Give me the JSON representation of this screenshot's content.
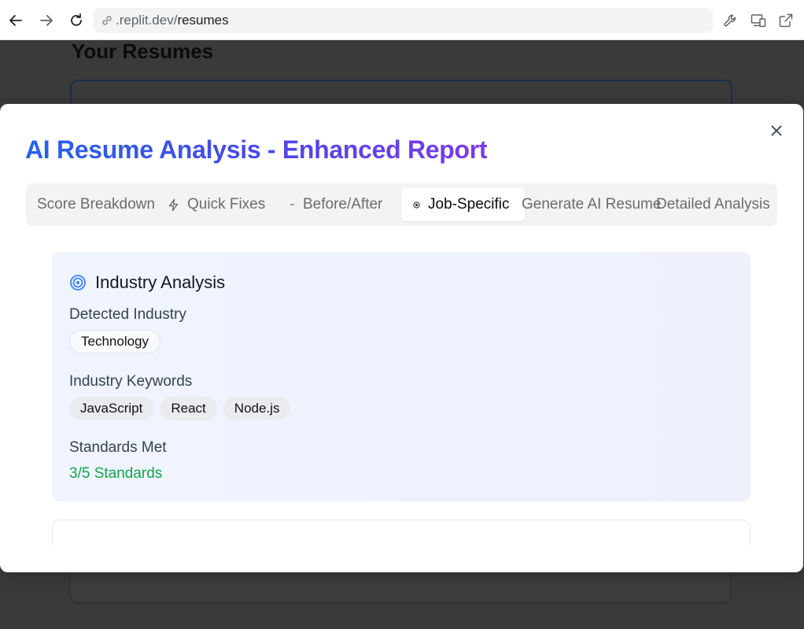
{
  "browser": {
    "url_prefix": ".replit.dev/",
    "url_path": "resumes",
    "icons": {
      "back": "arrow-left-icon",
      "forward": "arrow-right-icon",
      "reload": "reload-icon",
      "link": "link-icon",
      "tools": "wrench-icon",
      "devices": "devices-icon",
      "open": "external-link-icon"
    }
  },
  "background_page": {
    "title": "Your Resumes"
  },
  "modal": {
    "title": "AI Resume Analysis - Enhanced Report",
    "tabs": [
      {
        "label": "Score Breakdown",
        "icon": ""
      },
      {
        "label": "Quick Fixes",
        "icon": "zap-icon"
      },
      {
        "label": "Before/After",
        "icon": "dash-icon"
      },
      {
        "label": "Job-Specific",
        "icon": "target-small-icon",
        "active": true
      },
      {
        "label": "Generate AI Resume",
        "icon": ""
      },
      {
        "label": "Detailed Analysis",
        "icon": ""
      }
    ],
    "industry": {
      "title": "Industry Analysis",
      "detected_label": "Detected Industry",
      "detected_value": "Technology",
      "keywords_label": "Industry Keywords",
      "keywords": [
        "JavaScript",
        "React",
        "Node.js"
      ],
      "standards_label": "Standards Met",
      "standards_value": "3/5 Standards"
    },
    "colors": {
      "accent_start": "#2563eb",
      "accent_end": "#7c3aed",
      "success": "#16a34a"
    }
  }
}
